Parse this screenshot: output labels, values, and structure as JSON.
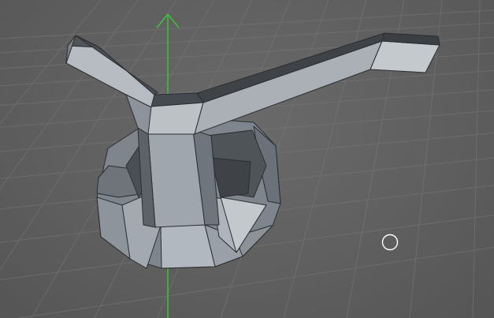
{
  "viewport": {
    "background": "#5f5f5f",
    "grid_color": "#787878",
    "axis_y_color": "#3bbf3b",
    "object_face_light": "#b7bcc2",
    "object_face_mid": "#8d939a",
    "object_face_dark": "#4a4f55",
    "object_edge": "#2a2d31"
  },
  "icons": {
    "axis": "y-axis-arrow-icon",
    "cursor": "brush-cursor-icon"
  }
}
